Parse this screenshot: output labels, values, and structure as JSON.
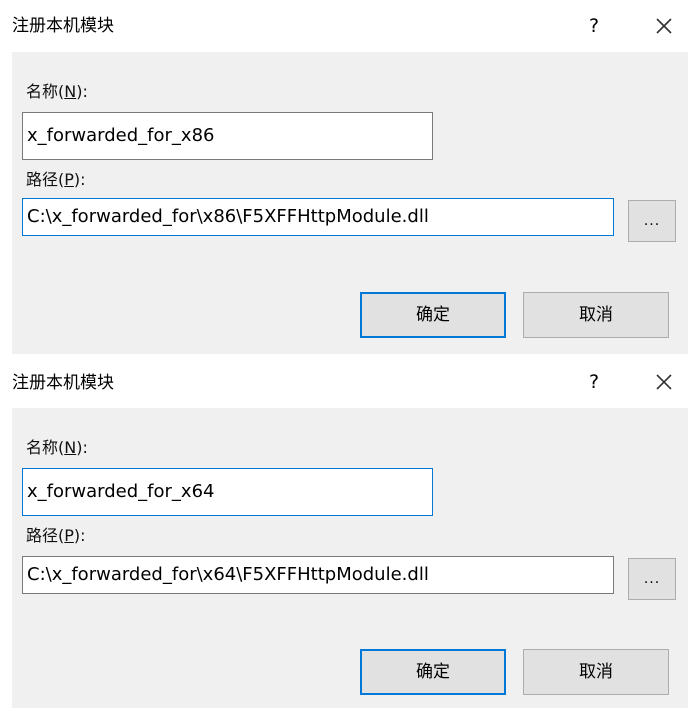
{
  "dialogs": [
    {
      "title": "注册本机模块",
      "help_label": "?",
      "name_label_pre": "名称(",
      "name_label_key": "N",
      "name_label_post": "):",
      "name_value": "x_forwarded_for_x86",
      "path_label_pre": "路径(",
      "path_label_key": "P",
      "path_label_post": "):",
      "path_value": "C:\\x_forwarded_for\\x86\\F5XFFHttpModule.dll",
      "browse_label": "...",
      "ok_label": "确定",
      "cancel_label": "取消"
    },
    {
      "title": "注册本机模块",
      "help_label": "?",
      "name_label_pre": "名称(",
      "name_label_key": "N",
      "name_label_post": "):",
      "name_value": "x_forwarded_for_x64",
      "path_label_pre": "路径(",
      "path_label_key": "P",
      "path_label_post": "):",
      "path_value": "C:\\x_forwarded_for\\x64\\F5XFFHttpModule.dll",
      "browse_label": "...",
      "ok_label": "确定",
      "cancel_label": "取消"
    }
  ],
  "colors": {
    "focus_border": "#0078d7",
    "dialog_body": "#f0f0f0",
    "button_face": "#e1e1e1"
  }
}
